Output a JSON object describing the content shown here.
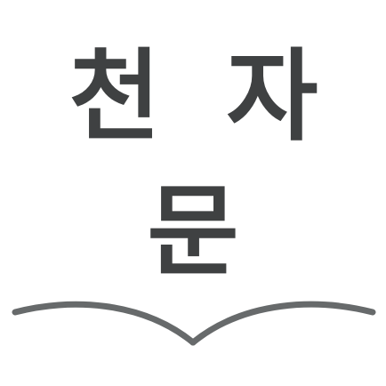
{
  "app_icon": {
    "title_chars": {
      "first": "천",
      "second": "자",
      "third": "문"
    },
    "icon": "open-book-icon",
    "colors": {
      "text": "#3f4142",
      "book_line": "#676a6b",
      "background": "#ffffff"
    }
  }
}
